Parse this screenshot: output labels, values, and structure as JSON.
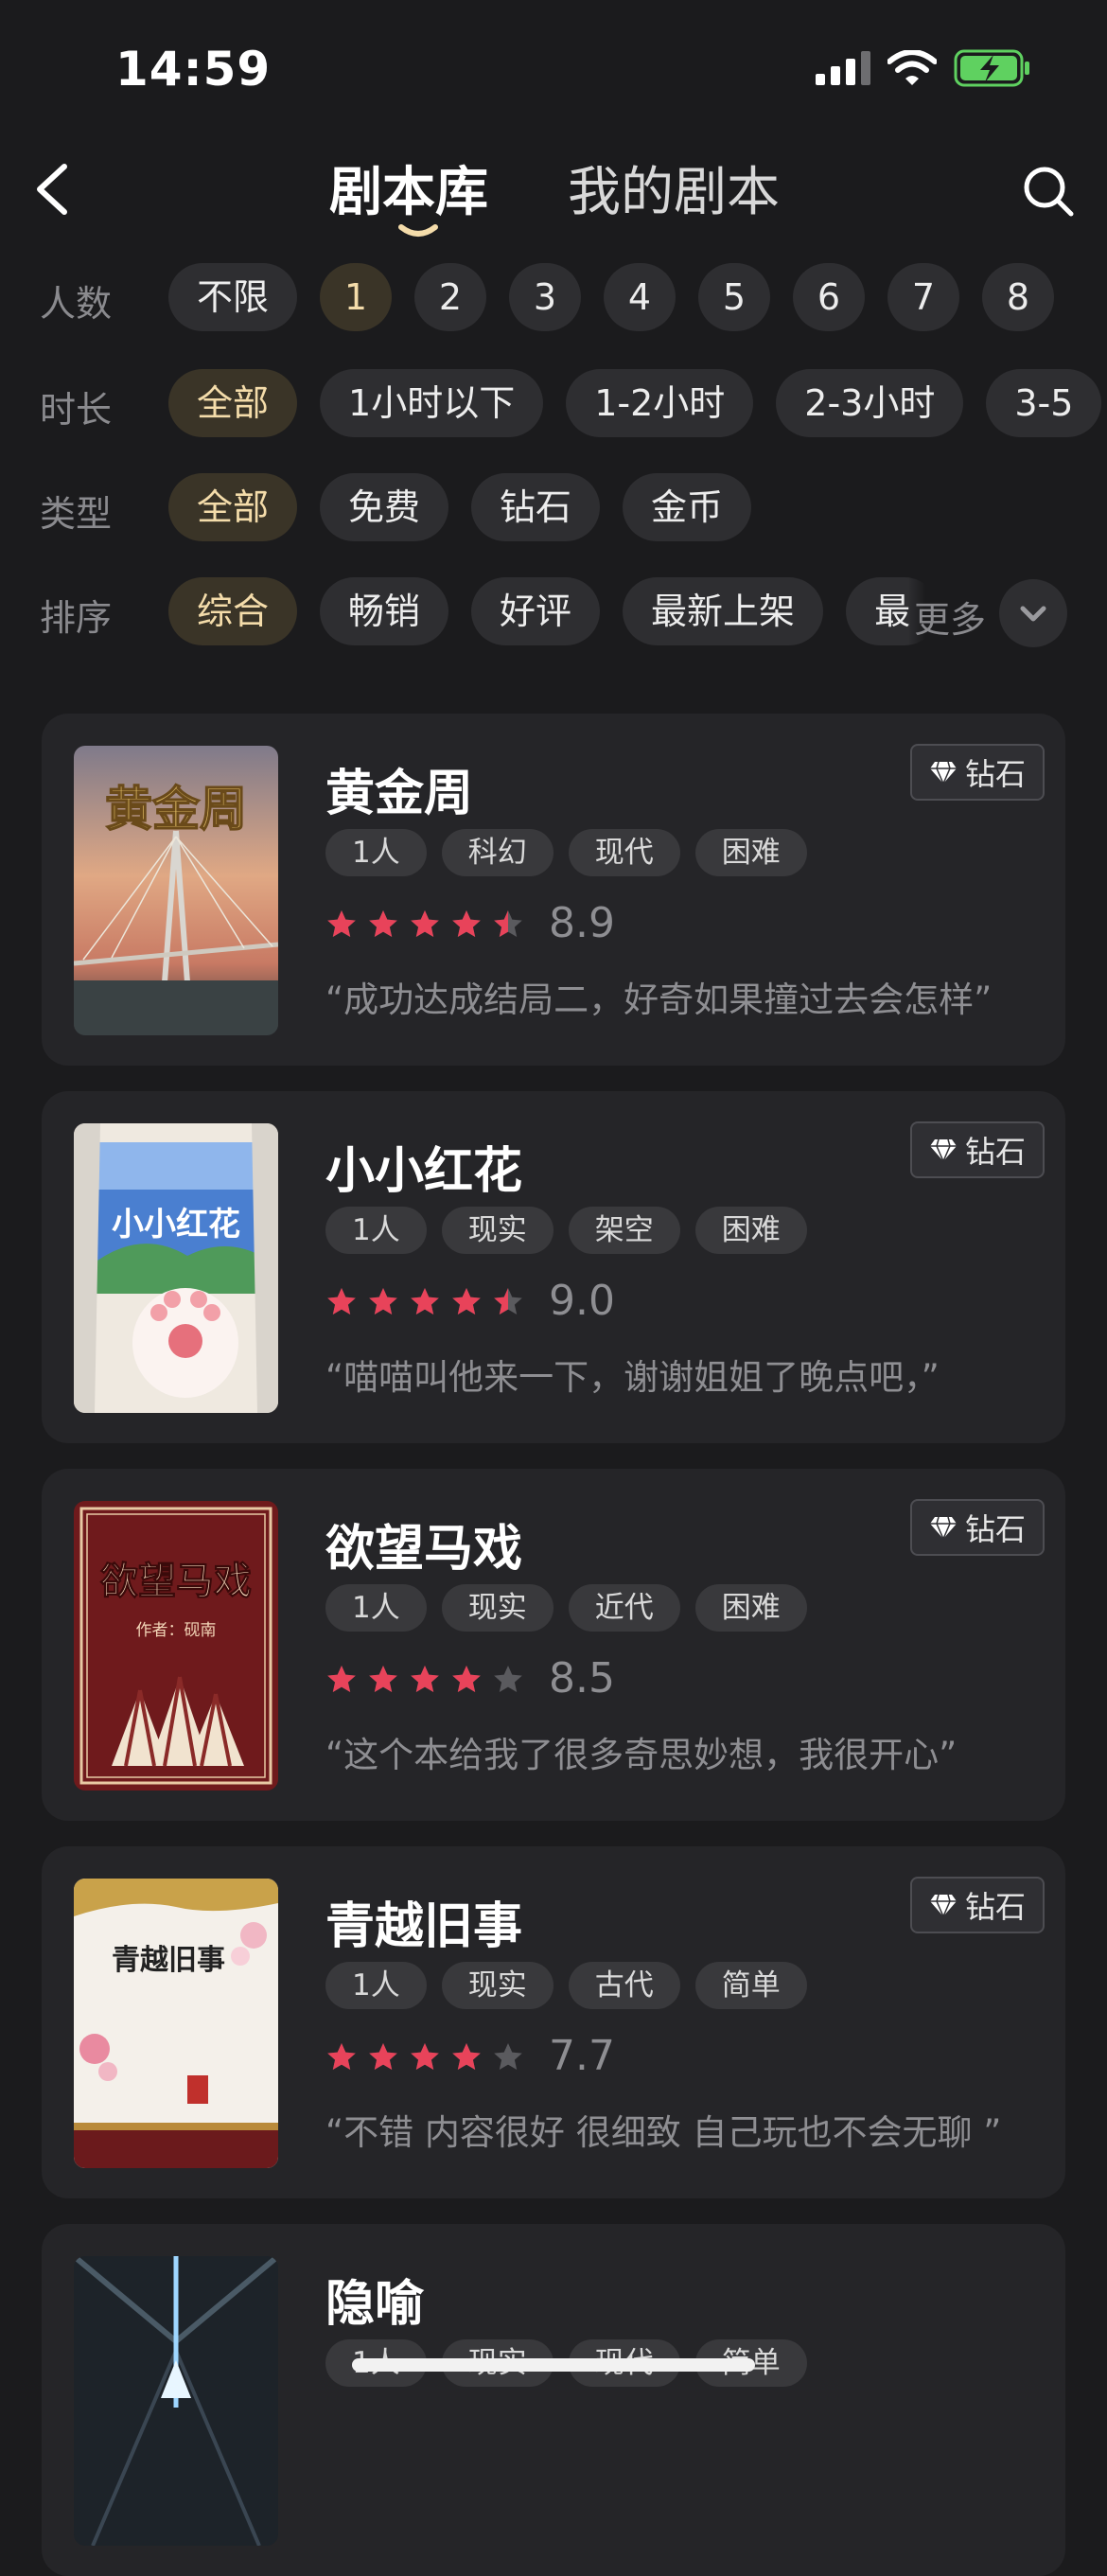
{
  "status_bar": {
    "time": "14:59"
  },
  "header": {
    "tabs": [
      {
        "label": "剧本库"
      },
      {
        "label": "我的剧本"
      }
    ]
  },
  "filters": [
    {
      "label": "人数",
      "options": [
        "不限",
        "1",
        "2",
        "3",
        "4",
        "5",
        "6",
        "7",
        "8"
      ],
      "selected": "1"
    },
    {
      "label": "时长",
      "options": [
        "全部",
        "1小时以下",
        "1-2小时",
        "2-3小时",
        "3-5"
      ],
      "selected": "全部"
    },
    {
      "label": "类型",
      "options": [
        "全部",
        "免费",
        "钻石",
        "金币"
      ],
      "selected": "全部"
    },
    {
      "label": "排序",
      "options": [
        "综合",
        "畅销",
        "好评",
        "最新上架",
        "最"
      ],
      "selected": "综合",
      "more_label": "更多"
    }
  ],
  "scripts": [
    {
      "title": "黄金周",
      "badge": "钻石",
      "tags": [
        "1人",
        "科幻",
        "现代",
        "困难"
      ],
      "score": "8.9",
      "stars": 4.5,
      "review": "“成功达成结局二，好奇如果撞过去会怎样”",
      "cover_text": "黄金周"
    },
    {
      "title": "小小红花",
      "badge": "钻石",
      "tags": [
        "1人",
        "现实",
        "架空",
        "困难"
      ],
      "score": "9.0",
      "stars": 4.5,
      "review": "“喵喵叫他来一下，谢谢姐姐了晚点吧，”",
      "cover_text": "小小红花"
    },
    {
      "title": "欲望马戏",
      "badge": "钻石",
      "tags": [
        "1人",
        "现实",
        "近代",
        "困难"
      ],
      "score": "8.5",
      "stars": 4,
      "review": "“这个本给我了很多奇思妙想，我很开心”",
      "cover_text": "欲望马戏",
      "cover_subtext": "作者：砚南"
    },
    {
      "title": "青越旧事",
      "badge": "钻石",
      "tags": [
        "1人",
        "现实",
        "古代",
        "简单"
      ],
      "score": "7.7",
      "stars": 4,
      "review": "“不错 内容很好 很细致 自己玩也不会无聊 ”",
      "cover_text": "青越旧事"
    },
    {
      "title": "隐喻",
      "tags": [
        "1人",
        "现实",
        "现代",
        "简单"
      ]
    }
  ],
  "colors": {
    "background": "#1b1b1d",
    "card": "#252528",
    "chip_active_text": "#f4dcaa",
    "star": "#e8435a",
    "star_empty": "#5a5a5e"
  }
}
